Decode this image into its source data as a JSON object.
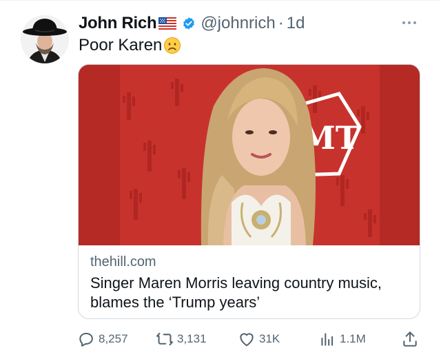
{
  "tweet": {
    "author": {
      "display_name": "John Rich",
      "handle": "@johnrich",
      "avatar_icon": "avatar-cowboy-hat",
      "flag_icon": "us-flag-emoji",
      "verified": true
    },
    "separator": "·",
    "time": "1d",
    "text": "Poor Karen",
    "emoji": "frowning-face-emoji"
  },
  "link_card": {
    "image_icon": "photo-woman-red-carpet",
    "image_logo_text": "MT",
    "domain": "thehill.com",
    "title": "Singer Maren Morris leaving country music, blames the ‘Trump years’"
  },
  "actions": {
    "replies": "8,257",
    "reposts": "3,131",
    "likes": "31K",
    "views": "1.1M"
  },
  "colors": {
    "text": "#0f1419",
    "secondary": "#536471",
    "verified_blue": "#1d9bf0",
    "border": "#cfd9de",
    "card_background_red": "#c8322c"
  }
}
